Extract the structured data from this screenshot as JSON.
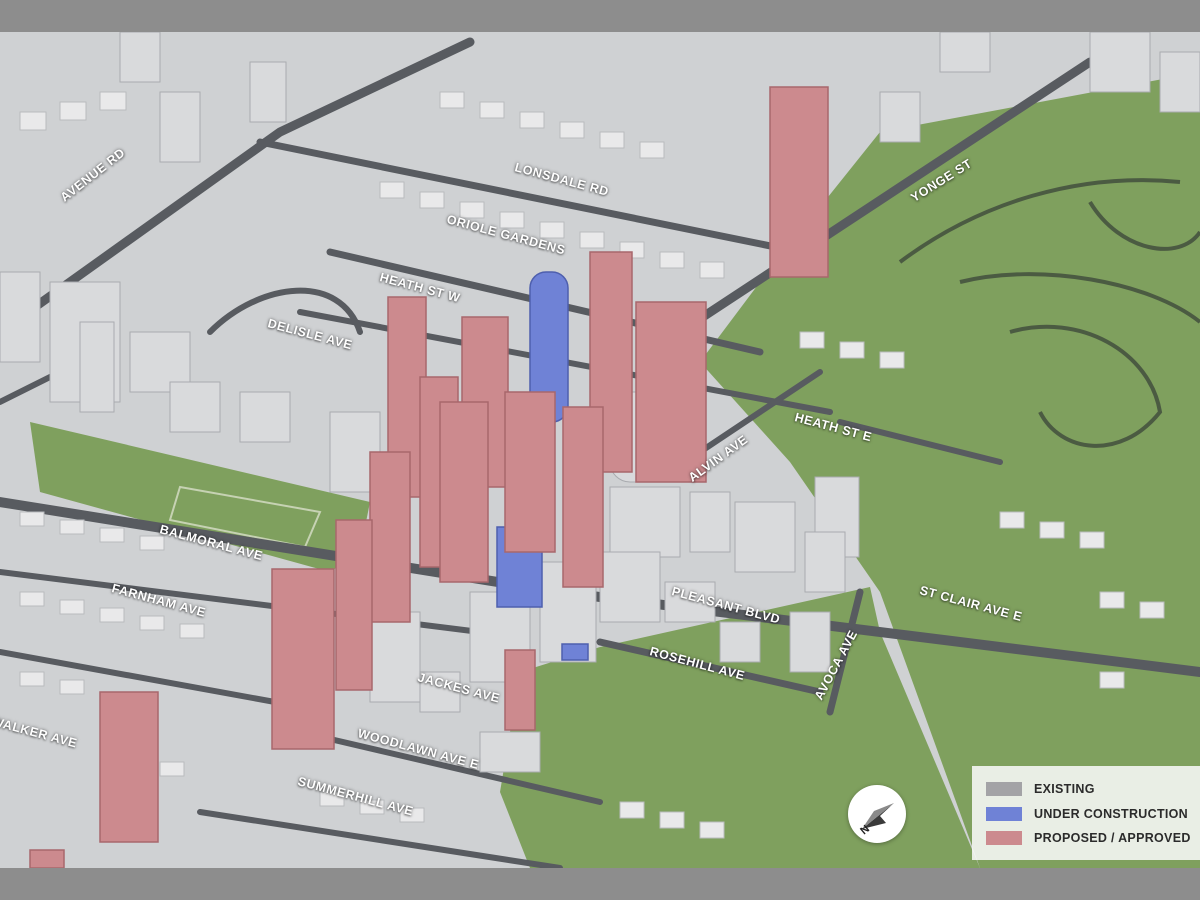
{
  "colors": {
    "existing": "#a3a3a6",
    "under_construction": "#6f82d6",
    "proposed": "#cc8a8e",
    "park": "#7fa05e",
    "road": "#585b60",
    "ground": "#cfd1d3"
  },
  "streets": [
    {
      "name": "AVENUE RD"
    },
    {
      "name": "LONSDALE RD"
    },
    {
      "name": "ORIOLE GARDENS"
    },
    {
      "name": "YONGE ST"
    },
    {
      "name": "HEATH ST W"
    },
    {
      "name": "DELISLE AVE"
    },
    {
      "name": "ALVIN AVE"
    },
    {
      "name": "HEATH ST E"
    },
    {
      "name": "BALMORAL AVE"
    },
    {
      "name": "FARNHAM AVE"
    },
    {
      "name": "PLEASANT BLVD"
    },
    {
      "name": "ST CLAIR AVE E"
    },
    {
      "name": "ROSEHILL AVE"
    },
    {
      "name": "AVOCA AVE"
    },
    {
      "name": "JACKES AVE"
    },
    {
      "name": "WALKER AVE"
    },
    {
      "name": "WOODLAWN AVE E"
    },
    {
      "name": "SUMMERHILL AVE"
    }
  ],
  "legend": [
    {
      "label": "EXISTING",
      "color": "#a3a3a6"
    },
    {
      "label": "UNDER CONSTRUCTION",
      "color": "#6f82d6"
    },
    {
      "label": "PROPOSED / APPROVED",
      "color": "#cc8a8e"
    }
  ],
  "compass": {
    "letter": "N",
    "icon": "north-arrow-icon"
  }
}
